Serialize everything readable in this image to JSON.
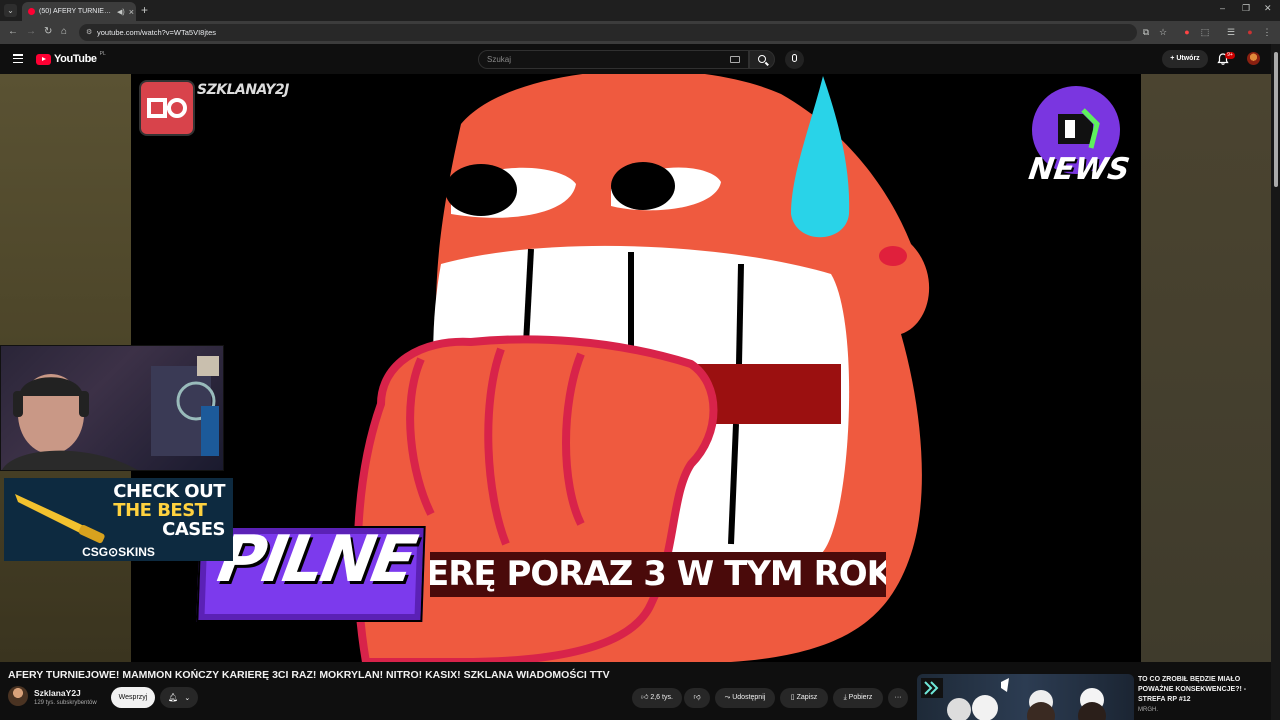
{
  "browser": {
    "tab_title": "(50) AFERY TURNIEJOWE! M",
    "url": "youtube.com/watch?v=WTa5VI8jtes",
    "new_tab": "+"
  },
  "header": {
    "logo_text": "YouTube",
    "logo_region": "PL",
    "search_placeholder": "Szukaj",
    "create_label": "Utwórz",
    "notification_count": "9+"
  },
  "video": {
    "watermark_text": "SZKLANAY2J",
    "news_logo_text": "NEWS",
    "banner_label": "PILNE",
    "ticker_text": "ERĘ PORAZ 3 W TYM ROKU!",
    "ad_line1": "CHECK OUT",
    "ad_line2": "THE BEST",
    "ad_line3": "CASES",
    "ad_brand": "CSG⊙SKINS"
  },
  "details": {
    "title": "AFERY TURNIEJOWE! MAMMON KOŃCZY KARIERĘ 3CI RAZ! MOKRYLAN! NITRO! KASIX! SZKLANA WIADOMOŚCI TTV",
    "channel_name": "SzklanaY2J",
    "subscribers": "129 tys. subskrybentów",
    "support_label": "Wesprzyj",
    "like_count": "2,6 tys.",
    "share_label": "Udostępnij",
    "save_label": "Zapisz",
    "download_label": "Pobierz",
    "more_label": "···"
  },
  "recommended": {
    "title": "TO CO ZROBIŁ BĘDZIE MIAŁO POWAŻNE KONSEKWENCJE?! - STREFA RP #12",
    "channel": "MRGH."
  },
  "colors": {
    "accent_red": "#ff0033",
    "banner_purple": "#7c3aed",
    "character_orange": "#ef5a3f"
  }
}
